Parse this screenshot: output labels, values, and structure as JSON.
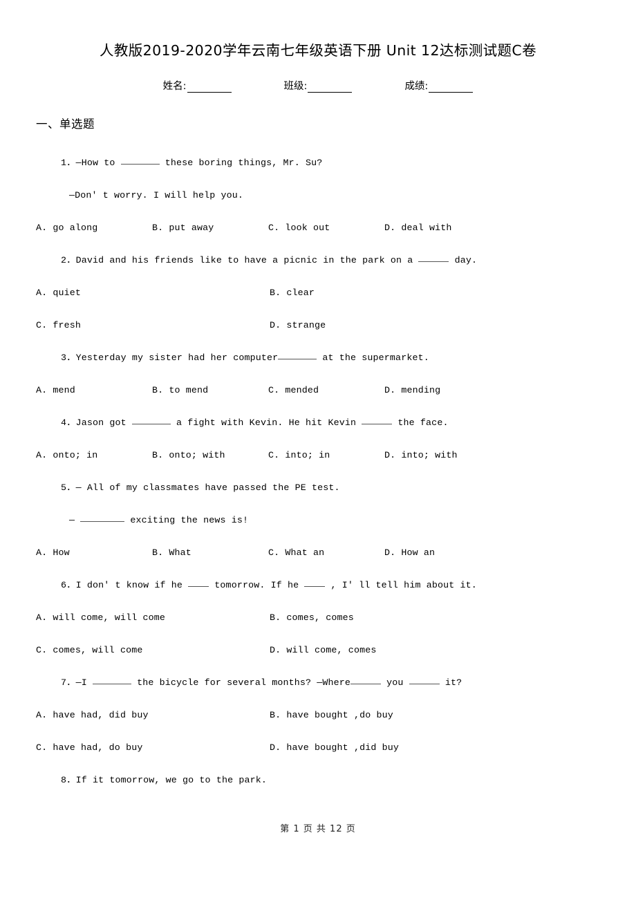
{
  "document": {
    "title": "人教版2019-2020学年云南七年级英语下册 Unit 12达标测试题C卷",
    "info_fields": [
      {
        "label": "姓名:"
      },
      {
        "label": "班级:"
      },
      {
        "label": "成绩:"
      }
    ],
    "footer": "第 1 页 共 12 页"
  },
  "sections": [
    {
      "heading": "一、单选题",
      "questions": [
        {
          "number": "1．",
          "stem_before": "—How to ",
          "gap": "gap-w3",
          "stem_after": " these boring things, Mr. Su?",
          "stem_line2": "—Don' t worry. I will help you.",
          "layout": "four-col",
          "options": [
            "A. go along",
            "B. put away",
            "C. look out",
            "D. deal with"
          ]
        },
        {
          "number": "2．",
          "stem_before": "David and his friends like to have a picnic in the park on a ",
          "gap": "gap-w2",
          "stem_after": " day.",
          "layout": "two-col",
          "options": [
            "A. quiet",
            "B. clear",
            "C. fresh",
            "D. strange"
          ]
        },
        {
          "number": "3．",
          "stem_before": "Yesterday my sister had her computer",
          "gap": "gap-w3",
          "stem_after": " at the supermarket.",
          "layout": "four-col",
          "options": [
            "A. mend",
            "B. to mend",
            "C. mended",
            "D. mending"
          ]
        },
        {
          "number": "4．",
          "stem_before": "Jason got ",
          "gap": "gap-w3",
          "stem_after": " a fight with Kevin. He hit Kevin ",
          "gap2": "gap-w2",
          "stem_after2": " the face.",
          "layout": "four-col",
          "options": [
            "A. onto; in",
            "B. onto; with",
            "C. into; in",
            "D. into; with"
          ]
        },
        {
          "number": "5．",
          "stem_before": "— All of my classmates have passed the PE test.",
          "stem_line2_before": "— ",
          "stem_line2_gap": "gap-w4",
          "stem_line2_after": " exciting the news is!",
          "layout": "four-col",
          "options": [
            "A. How",
            "B. What",
            "C. What an",
            "D. How an"
          ]
        },
        {
          "number": "6．",
          "stem_before": "I don' t know if he ",
          "gap": "gap-w1",
          "stem_after": " tomorrow. If he ",
          "gap2": "gap-w1",
          "stem_after2": " , I' ll tell him about it.",
          "layout": "two-col",
          "options": [
            "A. will come, will come",
            "B. comes, comes",
            "C. comes, will come",
            "D. will come, comes"
          ]
        },
        {
          "number": "7．",
          "stem_before": "—I ",
          "gap": "gap-w3",
          "stem_after": " the bicycle for several months?        —Where",
          "gap2": "gap-w2",
          "stem_after2": " you ",
          "gap3": "gap-w2",
          "stem_after3": " it?",
          "layout": "two-col",
          "options": [
            "A. have had, did buy",
            "B. have bought ,do buy",
            "C. have had, do buy",
            "D. have bought ,did buy"
          ]
        },
        {
          "number": "8．",
          "stem_before": "If it    tomorrow, we   go to the park.",
          "layout": "none",
          "options": []
        }
      ]
    }
  ]
}
